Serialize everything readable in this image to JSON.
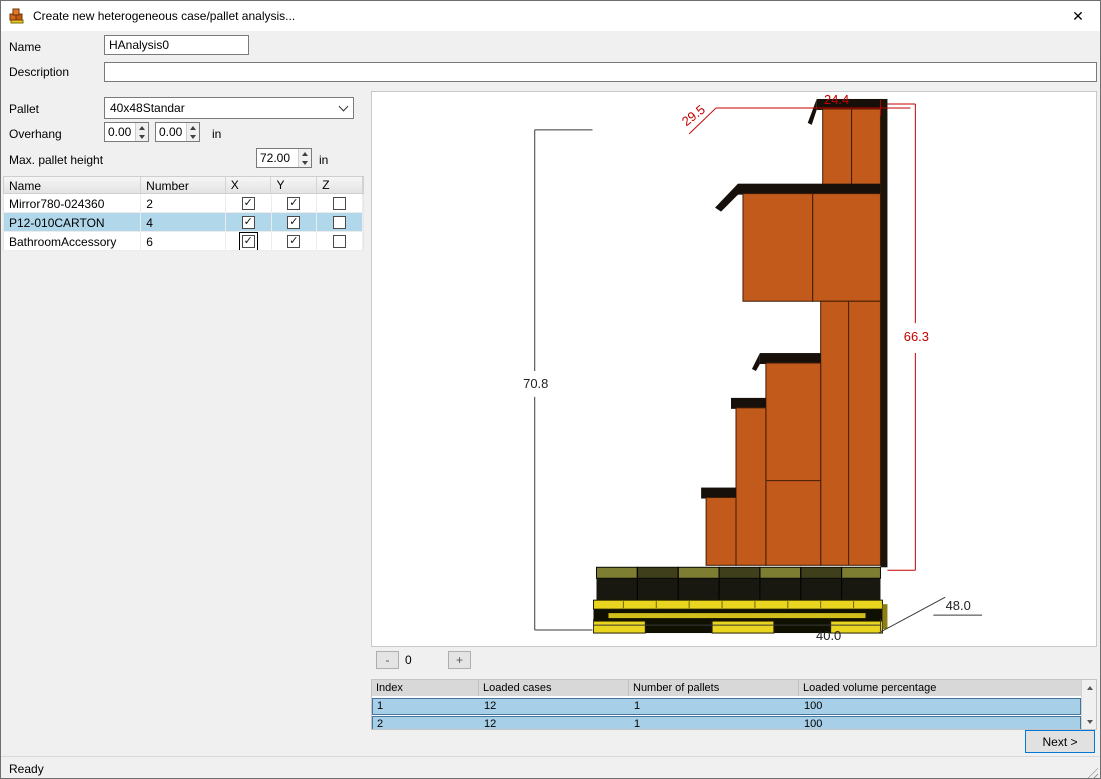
{
  "window": {
    "title": "Create new heterogeneous case/pallet analysis...",
    "close_glyph": "✕"
  },
  "glyphs": {
    "check": "✓"
  },
  "form": {
    "name": {
      "label": "Name",
      "value": "HAnalysis0"
    },
    "description": {
      "label": "Description",
      "value": ""
    },
    "pallet": {
      "label": "Pallet",
      "value": "40x48Standar"
    },
    "overhang": {
      "label": "Overhang",
      "x": "0.00",
      "y": "0.00",
      "unit": "in"
    },
    "max_height": {
      "label": "Max. pallet height",
      "value": "72.00",
      "unit": "in"
    }
  },
  "cases_table": {
    "headers": {
      "name": "Name",
      "number": "Number",
      "x": "X",
      "y": "Y",
      "z": "Z"
    },
    "rows": [
      {
        "name": "Mirror780-024360",
        "number": "2"
      },
      {
        "name": "P12-010CARTON",
        "number": "4"
      },
      {
        "name": "BathroomAccessory",
        "number": "6"
      }
    ]
  },
  "viewer": {
    "dims": {
      "depth_top": "29.5",
      "width_top": "24.4",
      "height_right": "66.3",
      "height_left": "70.8",
      "depth_bottom": "48.0",
      "width_bottom": "40.0"
    }
  },
  "pager": {
    "minus": "-",
    "value": "0",
    "plus": "+"
  },
  "results_table": {
    "headers": [
      "Index",
      "Loaded cases",
      "Number of pallets",
      "Loaded volume percentage"
    ],
    "rows": [
      {
        "index": "1",
        "loaded_cases": "12",
        "pallets": "1",
        "volume": "100"
      },
      {
        "index": "2",
        "loaded_cases": "12",
        "pallets": "1",
        "volume": "100"
      }
    ]
  },
  "footer": {
    "next_label": "Next >"
  },
  "status": {
    "text": "Ready"
  }
}
